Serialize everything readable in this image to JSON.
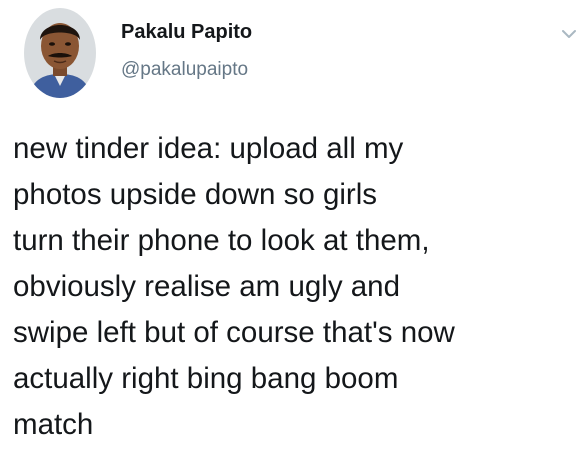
{
  "tweet": {
    "author": {
      "name": "Pakalu Papito",
      "handle": "@pakalupaipto",
      "avatar_icon": "user-photo"
    },
    "menu_icon": "chevron-down-icon",
    "text": "new tinder idea: upload all my\nphotos upside down so girls\nturn their phone to look at them,\nobviously realise am ugly and\nswipe left but of course that's now\nactually right bing bang boom\nmatch"
  },
  "colors": {
    "text_primary": "#14171a",
    "text_secondary": "#657786",
    "background": "#ffffff"
  }
}
